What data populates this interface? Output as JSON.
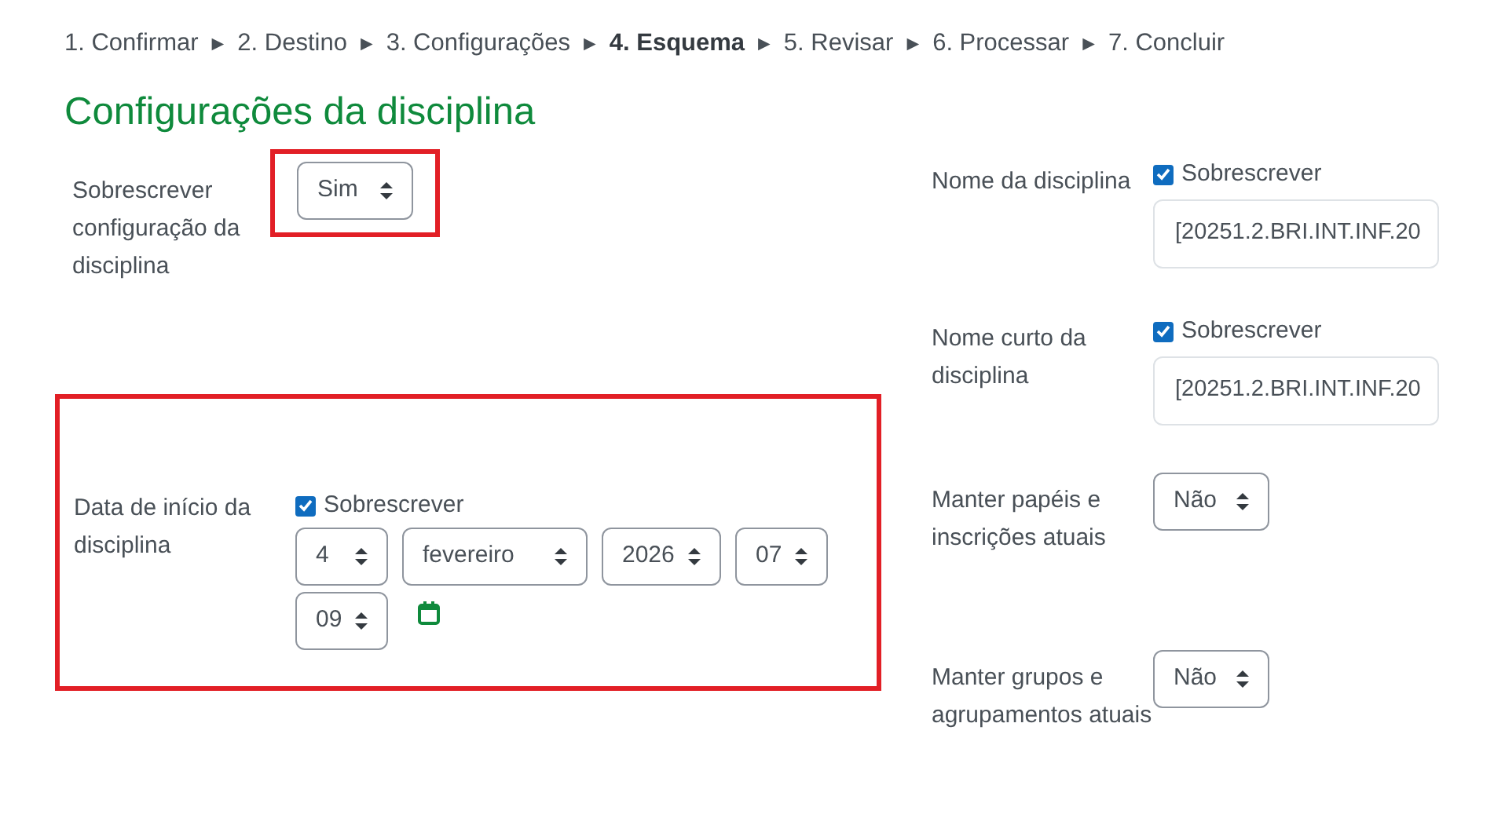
{
  "breadcrumb": [
    {
      "label": "1. Confirmar",
      "selected": false
    },
    {
      "label": "2. Destino",
      "selected": false
    },
    {
      "label": "3. Configurações",
      "selected": false
    },
    {
      "label": "4. Esquema",
      "selected": true
    },
    {
      "label": "5. Revisar",
      "selected": false
    },
    {
      "label": "6. Processar",
      "selected": false
    },
    {
      "label": "7. Concluir",
      "selected": false
    }
  ],
  "separators": [
    "►",
    "►",
    "►",
    "►",
    "►",
    "►"
  ],
  "heading": "Configurações da disciplina",
  "left_settings": [
    {
      "kind": "select",
      "label": "Sobrescrever configuração da disciplina",
      "value": "Sim",
      "highlighted": true
    },
    {
      "kind": "date",
      "label": "Data de início da disciplina",
      "override_label": "Sobrescrever",
      "checked": true,
      "highlighted": true,
      "parts": [
        "4",
        "fevereiro",
        "2026",
        "07",
        "09"
      ]
    }
  ],
  "right_settings": [
    {
      "kind": "text",
      "label": "Nome da disciplina",
      "override_label": "Sobrescrever",
      "checked": true,
      "value": "[20251.2.BRI.INT.INF.20"
    },
    {
      "kind": "text",
      "label": "Nome curto da disciplina",
      "override_label": "Sobrescrever",
      "checked": true,
      "value": "[20251.2.BRI.INT.INF.20"
    },
    {
      "kind": "select",
      "label": "Manter papéis e inscrições atuais",
      "value": "Não"
    },
    {
      "kind": "select",
      "label": "Manter grupos e agrupamentos atuais",
      "value": "Não"
    }
  ]
}
